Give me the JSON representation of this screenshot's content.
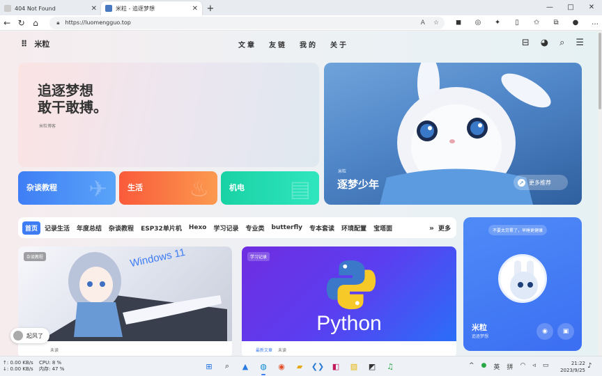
{
  "browser": {
    "tabs": [
      {
        "title": "404 Not Found",
        "active": false
      },
      {
        "title": "米粒 - 追逐梦想",
        "active": true
      }
    ],
    "new_tab": "+",
    "url": "https://luomengguo.top",
    "window_controls": [
      "—",
      "□",
      "✕"
    ]
  },
  "site": {
    "logo": "米粒",
    "menu": [
      "文章",
      "友链",
      "我的",
      "关于"
    ]
  },
  "hero": {
    "title": "追逐梦想\n敢干敢搏。",
    "subtitle": "米粒博客"
  },
  "categories": [
    {
      "label": "杂谈教程",
      "color": "#3f7ef6"
    },
    {
      "label": "生活",
      "color": "#fa5a3a"
    },
    {
      "label": "机电",
      "color": "#19d2a4"
    }
  ],
  "banner": {
    "small": "米粒",
    "title": "逐梦少年",
    "button": "更多推荐"
  },
  "category_bar": {
    "items": [
      "首页",
      "记录生活",
      "年度总结",
      "杂谈教程",
      "ESP32单片机",
      "Hexo",
      "学习记录",
      "专业类",
      "butterfly",
      "专本套读",
      "环境配置",
      "宝塔面"
    ],
    "arrows": "»",
    "more": "更多"
  },
  "posts": [
    {
      "tag": "杂谈教程",
      "image_text": "Windows 11",
      "meta": [
        "未读"
      ]
    },
    {
      "tag": "学习记录",
      "image_text": "Python",
      "meta": [
        "最新文章",
        "未读"
      ]
    }
  ],
  "profile": {
    "notice": "不要太劳累了，早睡更健康",
    "name": "米粒",
    "motto": "追逐梦想"
  },
  "float_button": "起风了",
  "taskbar": {
    "net_up": "↑: 0.00 KB/s",
    "net_down": "↓: 0.00 KB/s",
    "cpu": "CPU: 8 %",
    "mem": "内存: 47 %",
    "ime_lang": "英",
    "ime_mode": "拼",
    "time": "21:22",
    "date": "2023/9/25"
  },
  "colors": {
    "accent": "#3d7cf4"
  }
}
